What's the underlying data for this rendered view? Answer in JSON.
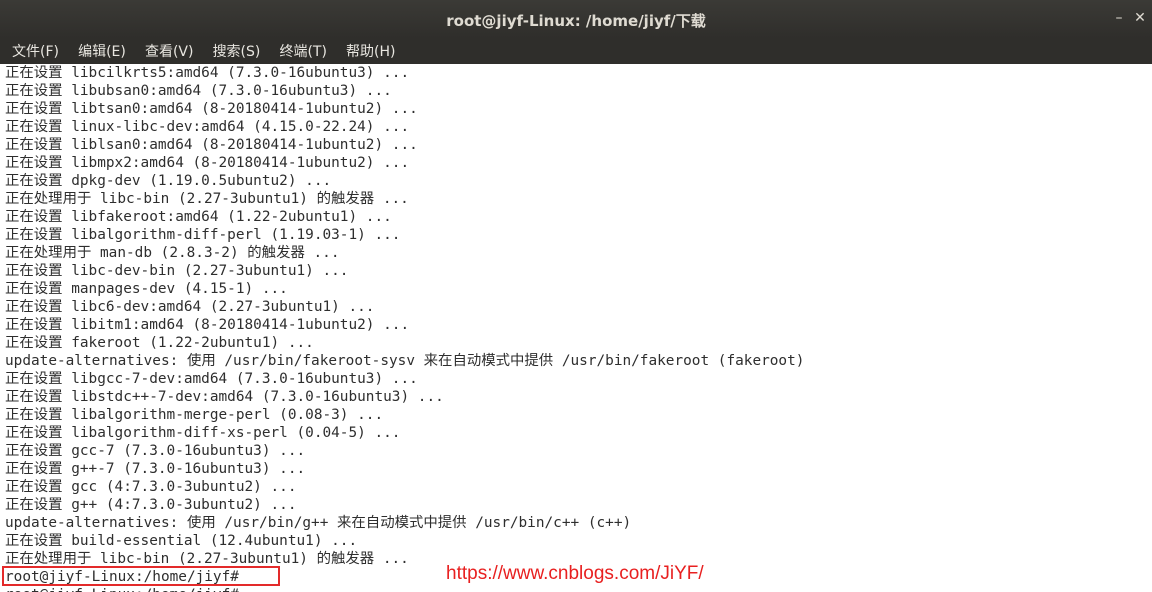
{
  "window": {
    "title": "root@jiyf-Linux: /home/jiyf/下载",
    "minimize_glyph": "–",
    "close_glyph": "✕"
  },
  "menu": [
    {
      "label": "文件(F)"
    },
    {
      "label": "编辑(E)"
    },
    {
      "label": "查看(V)"
    },
    {
      "label": "搜索(S)"
    },
    {
      "label": "终端(T)"
    },
    {
      "label": "帮助(H)"
    }
  ],
  "terminal": {
    "lines": [
      "正在设置 libcilkrts5:amd64 (7.3.0-16ubuntu3) ...",
      "正在设置 libubsan0:amd64 (7.3.0-16ubuntu3) ...",
      "正在设置 libtsan0:amd64 (8-20180414-1ubuntu2) ...",
      "正在设置 linux-libc-dev:amd64 (4.15.0-22.24) ...",
      "正在设置 liblsan0:amd64 (8-20180414-1ubuntu2) ...",
      "正在设置 libmpx2:amd64 (8-20180414-1ubuntu2) ...",
      "正在设置 dpkg-dev (1.19.0.5ubuntu2) ...",
      "正在处理用于 libc-bin (2.27-3ubuntu1) 的触发器 ...",
      "正在设置 libfakeroot:amd64 (1.22-2ubuntu1) ...",
      "正在设置 libalgorithm-diff-perl (1.19.03-1) ...",
      "正在处理用于 man-db (2.8.3-2) 的触发器 ...",
      "正在设置 libc-dev-bin (2.27-3ubuntu1) ...",
      "正在设置 manpages-dev (4.15-1) ...",
      "正在设置 libc6-dev:amd64 (2.27-3ubuntu1) ...",
      "正在设置 libitm1:amd64 (8-20180414-1ubuntu2) ...",
      "正在设置 fakeroot (1.22-2ubuntu1) ...",
      "update-alternatives: 使用 /usr/bin/fakeroot-sysv 来在自动模式中提供 /usr/bin/fakeroot (fakeroot)",
      "正在设置 libgcc-7-dev:amd64 (7.3.0-16ubuntu3) ...",
      "正在设置 libstdc++-7-dev:amd64 (7.3.0-16ubuntu3) ...",
      "正在设置 libalgorithm-merge-perl (0.08-3) ...",
      "正在设置 libalgorithm-diff-xs-perl (0.04-5) ...",
      "正在设置 gcc-7 (7.3.0-16ubuntu3) ...",
      "正在设置 g++-7 (7.3.0-16ubuntu3) ...",
      "正在设置 gcc (4:7.3.0-3ubuntu2) ...",
      "正在设置 g++ (4:7.3.0-3ubuntu2) ...",
      "update-alternatives: 使用 /usr/bin/g++ 来在自动模式中提供 /usr/bin/c++ (c++)",
      "正在设置 build-essential (12.4ubuntu1) ...",
      "正在处理用于 libc-bin (2.27-3ubuntu1) 的触发器 ...",
      "root@jiyf-Linux:/home/jiyf#",
      "root@jiyf-Linux:/home/jiyf#"
    ]
  },
  "watermark": "https://www.cnblogs.com/JiYF/",
  "colors": {
    "highlight_box": "#e32a2a",
    "watermark": "#e82020",
    "terminal_text": "#2e2e2e",
    "terminal_bg": "#ffffff",
    "titlebar": "#2f2e2b"
  }
}
